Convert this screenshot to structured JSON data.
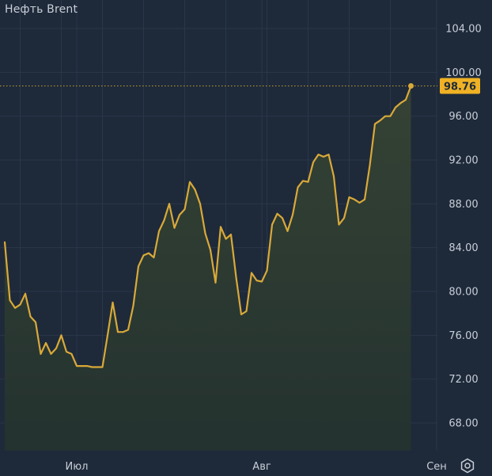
{
  "title": "Нефть Brent",
  "chart_data": {
    "type": "area",
    "title": "Нефть Brent",
    "xlabel": "",
    "ylabel": "",
    "ylim": [
      65,
      106
    ],
    "y_ticks": [
      68,
      72,
      76,
      80,
      84,
      88,
      92,
      96,
      100,
      104
    ],
    "y_tick_labels": [
      "68.00",
      "72.00",
      "76.00",
      "80.00",
      "84.00",
      "88.00",
      "92.00",
      "96.00",
      "100.00",
      "104.00"
    ],
    "x_tick_labels": [
      "Июл",
      "Авг",
      "Сен"
    ],
    "x_tick_positions": [
      14,
      50,
      84
    ],
    "last_value": 98.76,
    "last_value_label": "98.76",
    "grid": true,
    "series": [
      {
        "values": [
          84.5,
          79.2,
          78.5,
          78.8,
          79.8,
          77.7,
          77.2,
          74.3,
          75.3,
          74.3,
          74.8,
          76.0,
          74.5,
          74.3,
          73.2,
          73.2,
          73.2,
          73.1,
          73.1,
          73.1,
          76.0,
          79.0,
          76.3,
          76.3,
          76.5,
          78.7,
          82.3,
          83.3,
          83.5,
          83.1,
          85.5,
          86.5,
          88.0,
          85.8,
          87.0,
          87.5,
          90.0,
          89.3,
          88.0,
          85.3,
          83.8,
          80.8,
          85.9,
          84.8,
          85.2,
          81.3,
          77.9,
          78.2,
          81.7,
          81.0,
          80.9,
          81.9,
          86.1,
          87.1,
          86.7,
          85.5,
          87.0,
          89.5,
          90.1,
          90.0,
          91.8,
          92.5,
          92.3,
          92.5,
          90.5,
          86.1,
          86.7,
          88.6,
          88.4,
          88.1,
          88.4,
          91.5,
          95.3,
          95.6,
          96.0,
          96.0,
          96.8,
          97.2,
          97.5,
          98.76
        ]
      }
    ],
    "colors": {
      "background": "#1e2a3a",
      "grid": "#2a3748",
      "line": "#d9a939",
      "fill_top": "#354234",
      "fill_bottom": "#243230",
      "axis_text": "#c8ced8",
      "price_tag_bg": "#f0b224",
      "price_tag_text": "#1e2a3a",
      "price_line": "#c89a2e"
    }
  },
  "settings": {
    "icon": "settings-hexagon-icon"
  }
}
